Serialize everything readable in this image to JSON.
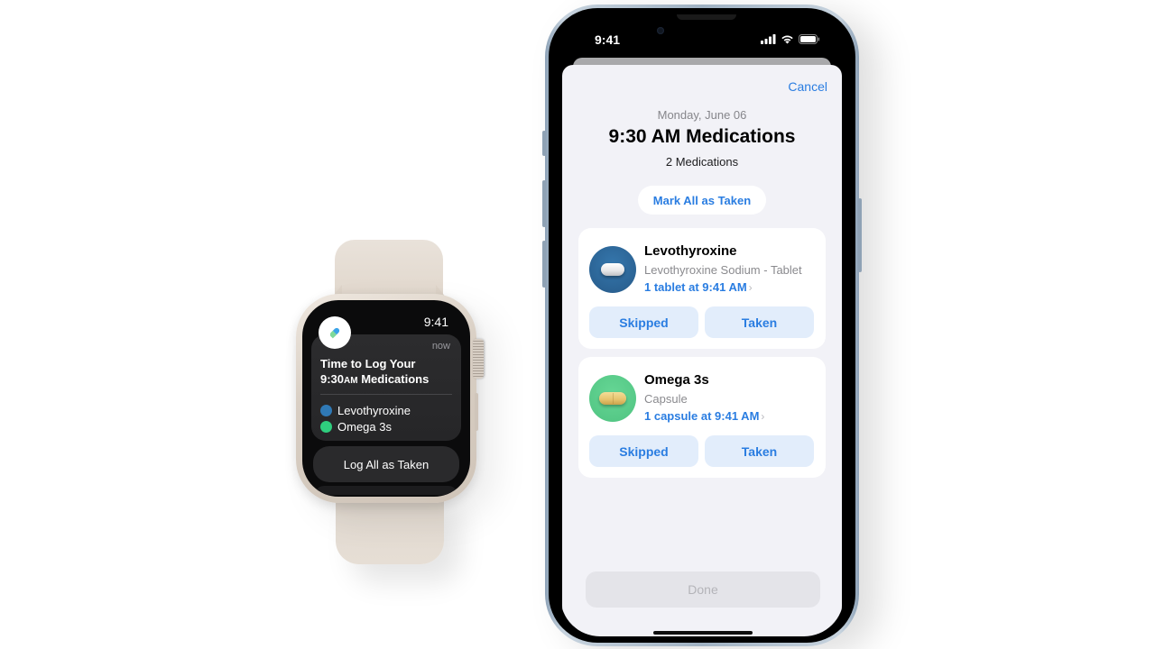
{
  "watch": {
    "time": "9:41",
    "app_icon": "pill-icon",
    "notification": {
      "timestamp": "now",
      "title_line1": "Time to Log Your",
      "title_line2_prefix": "9:30",
      "title_line2_ampm": "AM",
      "title_line2_suffix": " Medications",
      "medications": [
        {
          "name": "Levothyroxine",
          "color": "#2f79b6"
        },
        {
          "name": "Omega 3s",
          "color": "#2fce7e"
        }
      ]
    },
    "action_button": "Log All as Taken"
  },
  "phone": {
    "status_bar": {
      "time": "9:41",
      "icons": [
        "cellular-signal-icon",
        "wifi-icon",
        "battery-icon"
      ]
    },
    "sheet": {
      "cancel_label": "Cancel",
      "date": "Monday, June 06",
      "title": "9:30 AM Medications",
      "count": "2 Medications",
      "mark_all_label": "Mark All as Taken",
      "medications": [
        {
          "name": "Levothyroxine",
          "description": "Levothyroxine Sodium - Tablet",
          "dose": "1 tablet at 9:41 AM",
          "icon": "tablet-pill-icon",
          "icon_bg": "#2f6a9c",
          "skipped_label": "Skipped",
          "taken_label": "Taken"
        },
        {
          "name": "Omega 3s",
          "description": "Capsule",
          "dose": "1 capsule at 9:41 AM",
          "icon": "capsule-pill-icon",
          "icon_bg": "#5ccf8c",
          "skipped_label": "Skipped",
          "taken_label": "Taken"
        }
      ],
      "done_label": "Done"
    }
  },
  "colors": {
    "accent": "#2a7de1",
    "sheet_bg": "#f2f2f7",
    "button_tint": "#e2edfb"
  }
}
